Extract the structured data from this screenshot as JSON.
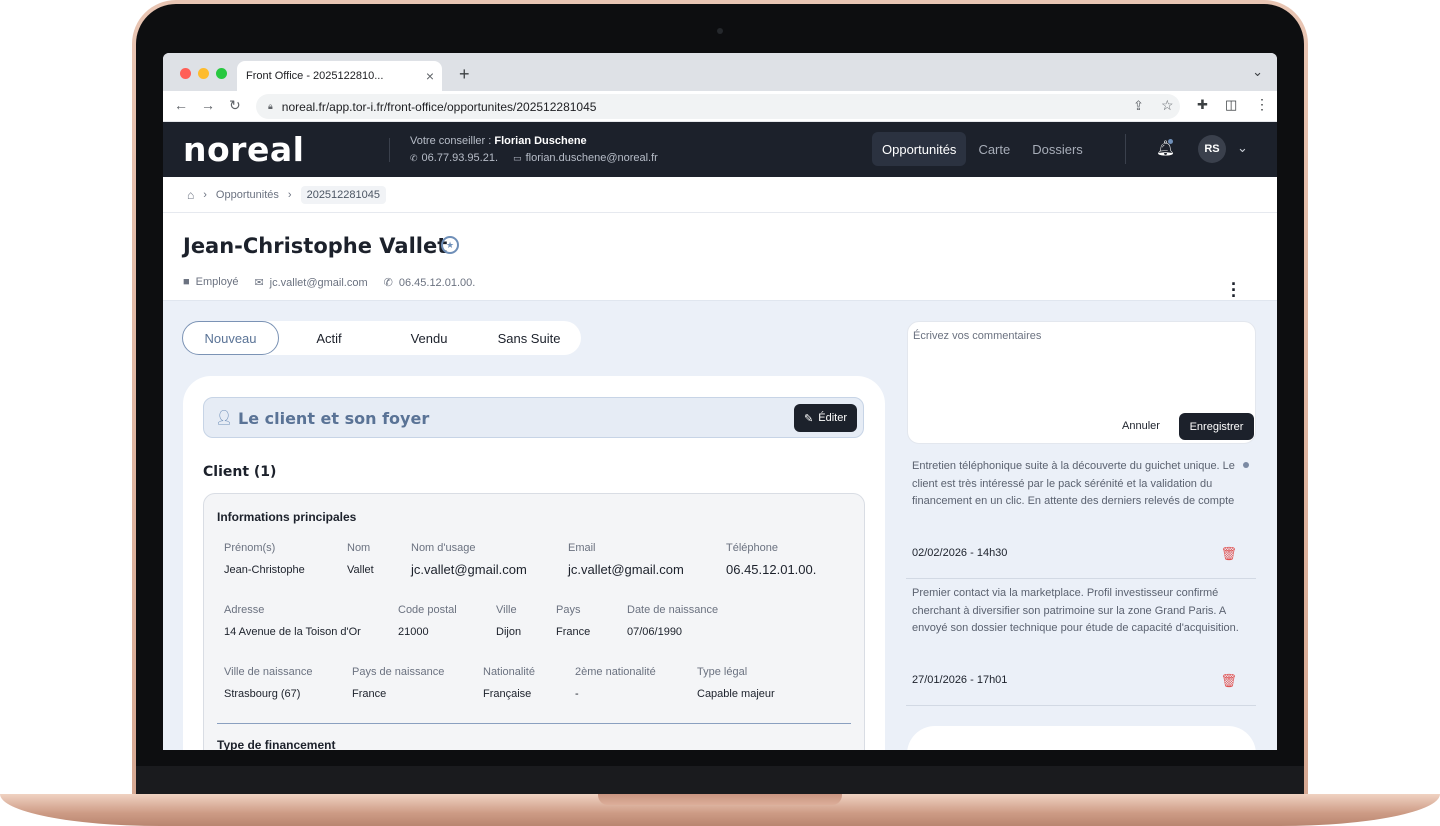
{
  "browser": {
    "tab_title": "Front Office - 2025122810...",
    "tab_close": "×",
    "new_tab": "+",
    "url": "noreal.fr/app.tor-i.fr/front-office/opportunites/202512281045"
  },
  "header": {
    "logo": "noreal",
    "advisor_prefix": "Votre conseiller : ",
    "advisor_name": "Florian Duschene",
    "advisor_phone": "06.77.93.95.21.",
    "advisor_email": "florian.duschene@noreal.fr",
    "nav": [
      "Opportunités",
      "Carte",
      "Dossiers"
    ],
    "active_nav": "Opportunités",
    "avatar_initials": "RS"
  },
  "breadcrumb": {
    "items": [
      "Opportunités",
      "202512281045"
    ]
  },
  "person": {
    "name": "Jean-Christophe Vallet",
    "role": "Employé",
    "email": "jc.vallet@gmail.com",
    "phone": "06.45.12.01.00."
  },
  "status_tabs": [
    "Nouveau",
    "Actif",
    "Vendu",
    "Sans Suite"
  ],
  "active_status": "Nouveau",
  "section": {
    "title": "Le client et son foyer",
    "edit_label": "Éditer",
    "client_count_title": "Client (1)",
    "info_title": "Informations principales",
    "fields": {
      "prenom": {
        "label": "Prénom(s)",
        "value": "Jean-Christophe"
      },
      "nom": {
        "label": "Nom",
        "value": "Vallet"
      },
      "nom_usage": {
        "label": "Nom d'usage",
        "value": "jc.vallet@gmail.com"
      },
      "email": {
        "label": "Email",
        "value": "jc.vallet@gmail.com"
      },
      "telephone": {
        "label": "Téléphone",
        "value": "06.45.12.01.00."
      },
      "adresse": {
        "label": "Adresse",
        "value": "14 Avenue de la Toison d'Or"
      },
      "code_postal": {
        "label": "Code postal",
        "value": "21000"
      },
      "ville": {
        "label": "Ville",
        "value": "Dijon"
      },
      "pays": {
        "label": "Pays",
        "value": "France"
      },
      "date_naissance": {
        "label": "Date de naissance",
        "value": "07/06/1990"
      },
      "ville_naissance": {
        "label": "Ville de naissance",
        "value": "Strasbourg (67)"
      },
      "pays_naissance": {
        "label": "Pays de naissance",
        "value": "France"
      },
      "nationalite": {
        "label": "Nationalité",
        "value": "Française"
      },
      "nationalite2": {
        "label": "2ème nationalité",
        "value": "-"
      },
      "type_legal": {
        "label": "Type légal",
        "value": "Capable majeur"
      }
    },
    "financing_title": "Type de financement"
  },
  "comments": {
    "placeholder": "Écrivez vos commentaires",
    "cancel_label": "Annuler",
    "save_label": "Enregistrer",
    "notes": [
      {
        "text": "Entretien téléphonique suite à la découverte du guichet unique. Le client est très intéressé par le pack sérénité et la validation du financement en un clic. En attente des derniers relevés de compte",
        "date": "02/02/2026 - 14h30"
      },
      {
        "text": "Premier contact via la marketplace. Profil investisseur confirmé cherchant à diversifier son patrimoine sur la zone Grand Paris. A envoyé son dossier technique pour étude de capacité d'acquisition.",
        "date": "27/01/2026 - 17h01"
      }
    ]
  },
  "colors": {
    "header_bg": "#1c212b",
    "accent": "#6f8fb8",
    "danger": "#e05252",
    "page_bg": "#ebf0f8"
  }
}
